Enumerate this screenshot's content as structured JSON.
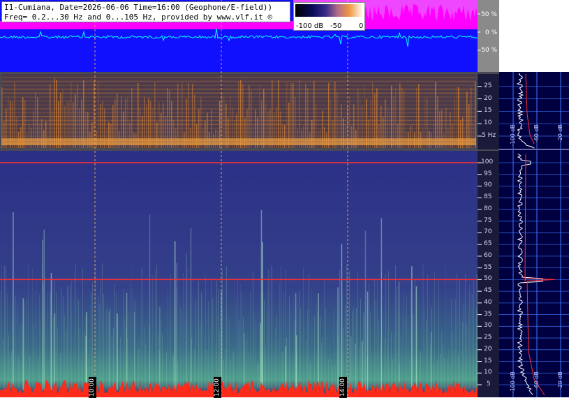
{
  "header": {
    "title_line1": "I1-Cumiana, Date=2026-06-06 Time=16:00 (Geophone/E-field))",
    "title_line2": "Freq= 0.2...30 Hz and 0...105 Hz, provided by www.vlf.it ©"
  },
  "scale": {
    "labels": [
      "-100 dB",
      "-50",
      "0"
    ]
  },
  "colors": {
    "waveform_bg": "#1010ff",
    "waveform_upper": "#ff00ff",
    "waveform_trace": "#00ffff",
    "spec_bg": "#2b2f86",
    "low_spec_bg": "#4a3a4a",
    "band_orange": "#e2862e",
    "noise_red": "#ff2a1a",
    "mains_line": "#ff3030",
    "side_panel": "#000040",
    "grid": "#3d78ff",
    "marker_line": "#ffb060"
  },
  "chart_data": [
    {
      "type": "line",
      "name": "waveform",
      "ylabel_ticks": [
        "50 %",
        "0 %",
        "-50 %"
      ],
      "y": [
        50,
        0,
        -50
      ]
    },
    {
      "type": "heatmap",
      "name": "low-frequency spectrogram",
      "ylim": [
        0.2,
        30
      ],
      "y_ticks": [
        "25",
        "20",
        "15",
        "10",
        "5 Hz"
      ],
      "y_tick_values": [
        25,
        20,
        15,
        10,
        5
      ]
    },
    {
      "type": "heatmap",
      "name": "high-frequency spectrogram",
      "ylim": [
        0,
        105
      ],
      "y_ticks": [
        "100",
        "95",
        "90",
        "85",
        "80",
        "75",
        "70",
        "65",
        "60",
        "55",
        "50",
        "45",
        "40",
        "35",
        "30",
        "25",
        "20",
        "15",
        "10",
        "5"
      ],
      "y_tick_values": [
        100,
        95,
        90,
        85,
        80,
        75,
        70,
        65,
        60,
        55,
        50,
        45,
        40,
        35,
        30,
        25,
        20,
        15,
        10,
        5
      ],
      "x_ticks": [
        "10:00",
        "12:00",
        "14:00"
      ],
      "x_tick_values": [
        10,
        12,
        14
      ],
      "strong_lines_hz": [
        100,
        50
      ]
    },
    {
      "type": "line",
      "name": "average spectrum",
      "x_ticks_top": [
        "-100 dB",
        "-60 dB",
        "-20 dB"
      ],
      "x_ticks_bottom": [
        "-100 dB",
        "-60 dB",
        "-20 dB"
      ],
      "x_tick_values": [
        -100,
        -60,
        -20
      ]
    }
  ]
}
